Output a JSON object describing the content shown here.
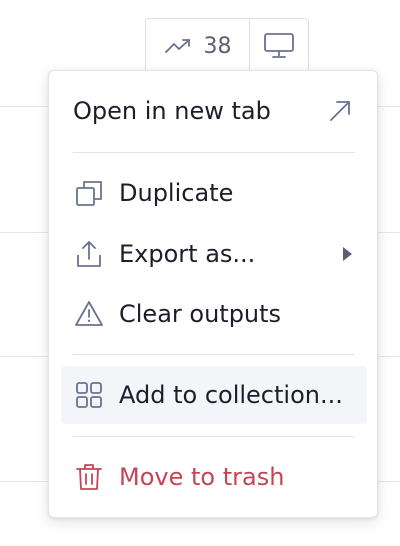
{
  "toolbar": {
    "trend_icon": "trending-up-icon",
    "trend_count": "38",
    "display_icon": "monitor-icon"
  },
  "menu": {
    "items": [
      {
        "label": "Open in new tab",
        "icon": "",
        "trailing_icon": "arrow-up-right-icon"
      },
      {
        "label": "Duplicate",
        "icon": "duplicate-icon"
      },
      {
        "label": "Export as...",
        "icon": "export-icon",
        "trailing_icon": "caret-right-icon"
      },
      {
        "label": "Clear outputs",
        "icon": "warning-icon"
      },
      {
        "label": "Add to collection...",
        "icon": "grid-icon",
        "highlighted": true
      },
      {
        "label": "Move to trash",
        "icon": "trash-icon",
        "danger": true
      }
    ]
  },
  "colors": {
    "text": "#1c1e2b",
    "icon": "#6b7190",
    "danger": "#c64454",
    "hover_bg": "#f4f5f8",
    "border": "#e2e4ea"
  }
}
